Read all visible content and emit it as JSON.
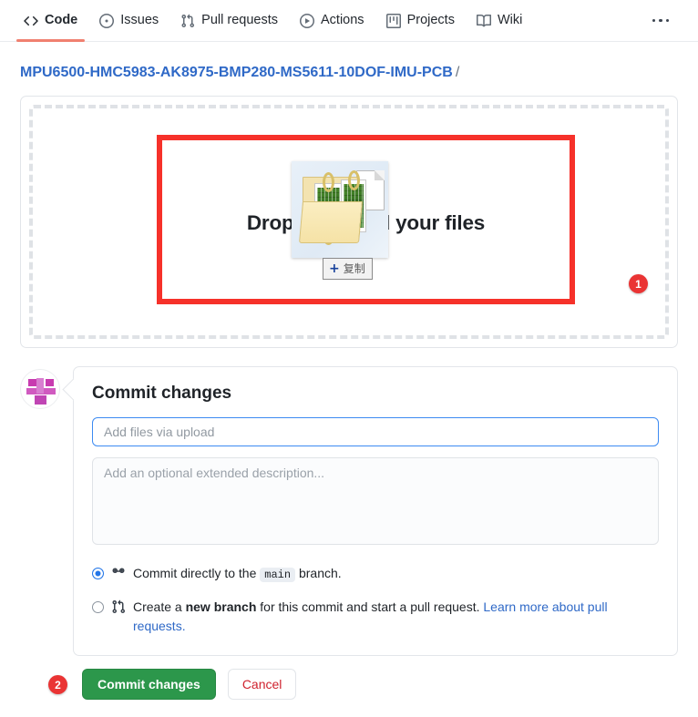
{
  "nav": {
    "tabs": [
      {
        "label": "Code",
        "icon": "code-icon",
        "active": true
      },
      {
        "label": "Issues",
        "icon": "issue-opened-icon",
        "active": false
      },
      {
        "label": "Pull requests",
        "icon": "git-pull-request-icon",
        "active": false
      },
      {
        "label": "Actions",
        "icon": "play-circle-icon",
        "active": false
      },
      {
        "label": "Projects",
        "icon": "project-board-icon",
        "active": false
      },
      {
        "label": "Wiki",
        "icon": "book-icon",
        "active": false
      }
    ],
    "overflow_label": "..."
  },
  "breadcrumb": {
    "repo": "MPU6500-HMC5983-AK8975-BMP280-MS5611-10DOF-IMU-PCB",
    "separator": "/"
  },
  "upload": {
    "drop_text": "Drop to upload your files",
    "drag_tooltip": "复制",
    "drag_tooltip_plus": "+",
    "annotation_badge": "1"
  },
  "commit": {
    "title": "Commit changes",
    "message_placeholder": "Add files via upload",
    "message_value": "",
    "description_placeholder": "Add an optional extended description...",
    "description_value": "",
    "option_direct": {
      "text_before": "Commit directly to the",
      "branch": "main",
      "text_after": "branch.",
      "selected": true
    },
    "option_new_branch": {
      "text_before": "Create a",
      "emphasis": "new branch",
      "text_after": "for this commit and start a pull request.",
      "link": "Learn more about pull requests.",
      "selected": false
    }
  },
  "actions": {
    "annotation_badge": "2",
    "commit_button": "Commit changes",
    "cancel_button": "Cancel"
  },
  "colors": {
    "accent_blue": "#2f69c7",
    "active_tab_underline": "#f08070",
    "annotation_red": "#ea3434",
    "highlight_red": "#f6312a",
    "commit_green": "#2c974b",
    "cancel_red": "#cf222e"
  }
}
